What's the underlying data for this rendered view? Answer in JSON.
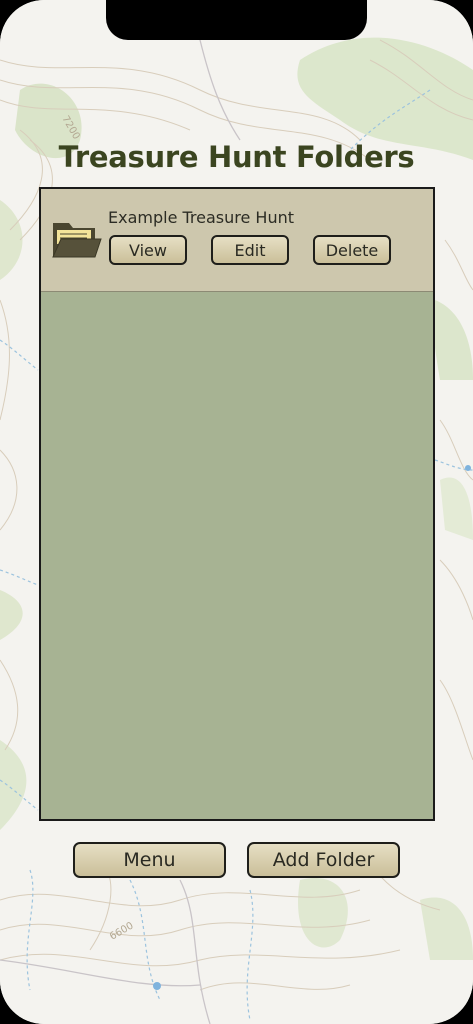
{
  "header": {
    "title": "Treasure Hunt Folders"
  },
  "folders": [
    {
      "name": "Example Treasure Hunt",
      "icon": "folder-open-icon",
      "view_label": "View",
      "edit_label": "Edit",
      "delete_label": "Delete"
    }
  ],
  "footer": {
    "menu_label": "Menu",
    "add_folder_label": "Add Folder"
  },
  "map": {
    "contour_labels": [
      "7200",
      "6600"
    ]
  },
  "colors": {
    "title": "#3b4520",
    "panel": "#a7b393",
    "folder_row": "#cdc7ad",
    "button": "#d9d0b0",
    "folder_icon": "#4a4630",
    "folder_paper": "#f3e49a"
  }
}
